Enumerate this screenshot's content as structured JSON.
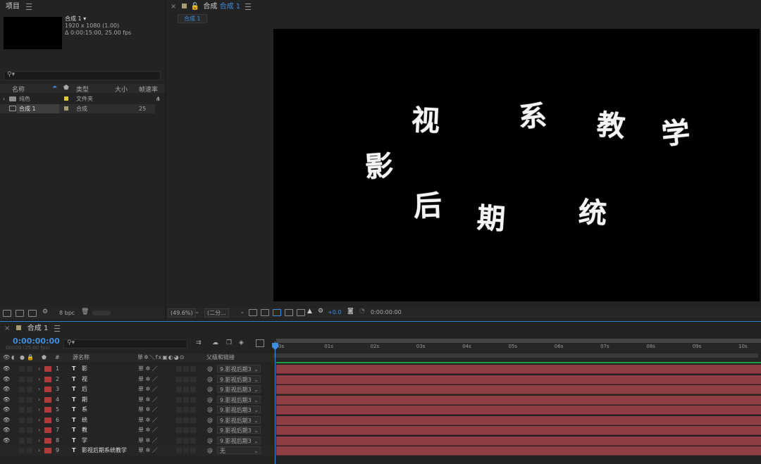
{
  "project_panel": {
    "title": "项目",
    "comp_name": "合成 1",
    "comp_info_size": "1920 x 1080 (1.00)",
    "comp_info_duration": "Δ 0:00:15:00, 25.00 fps",
    "columns": {
      "name": "名称",
      "type": "类型",
      "size": "大小",
      "fps": "帧速率"
    },
    "rows": [
      {
        "name": "纯色",
        "type": "文件夹",
        "fps": "",
        "color": "#e1c93a"
      },
      {
        "name": "合成 1",
        "type": "合成",
        "fps": "25",
        "color": "#a89a72"
      }
    ],
    "bpc": "8 bpc"
  },
  "viewer": {
    "tab_prefix": "合成",
    "tab_comp": "合成 1",
    "sub_tab": "合成 1",
    "zoom": "(49.6%)",
    "resolution": "(二分...",
    "exposure": "+0.0",
    "timecode": "0:00:00:00",
    "glyphs": [
      {
        "char": "影"
      },
      {
        "char": "视"
      },
      {
        "char": "后"
      },
      {
        "char": "期"
      },
      {
        "char": "系"
      },
      {
        "char": "统"
      },
      {
        "char": "教"
      },
      {
        "char": "学"
      }
    ]
  },
  "timeline": {
    "tab": "合成 1",
    "timecode": "0:00:00:00",
    "frame_info": "00000 (25.00 fps)",
    "columns": {
      "num": "#",
      "name": "源名称",
      "parent": "父级和链接"
    },
    "ruler": [
      "0s",
      "01s",
      "02s",
      "03s",
      "04s",
      "05s",
      "06s",
      "07s",
      "08s",
      "09s",
      "10s"
    ],
    "layers": [
      {
        "num": "1",
        "type": "T",
        "name": "影",
        "parent": "9.影视后期3"
      },
      {
        "num": "2",
        "type": "T",
        "name": "视",
        "parent": "9.影视后期3"
      },
      {
        "num": "3",
        "type": "T",
        "name": "后",
        "parent": "9.影视后期3"
      },
      {
        "num": "4",
        "type": "T",
        "name": "期",
        "parent": "9.影视后期3"
      },
      {
        "num": "5",
        "type": "T",
        "name": "系",
        "parent": "9.影视后期3"
      },
      {
        "num": "6",
        "type": "T",
        "name": "统",
        "parent": "9.影视后期3"
      },
      {
        "num": "7",
        "type": "T",
        "name": "教",
        "parent": "9.影视后期3"
      },
      {
        "num": "8",
        "type": "T",
        "name": "学",
        "parent": "9.影视后期3"
      },
      {
        "num": "9",
        "type": "T",
        "name": "影视后期系统教学",
        "parent": "无"
      }
    ]
  }
}
